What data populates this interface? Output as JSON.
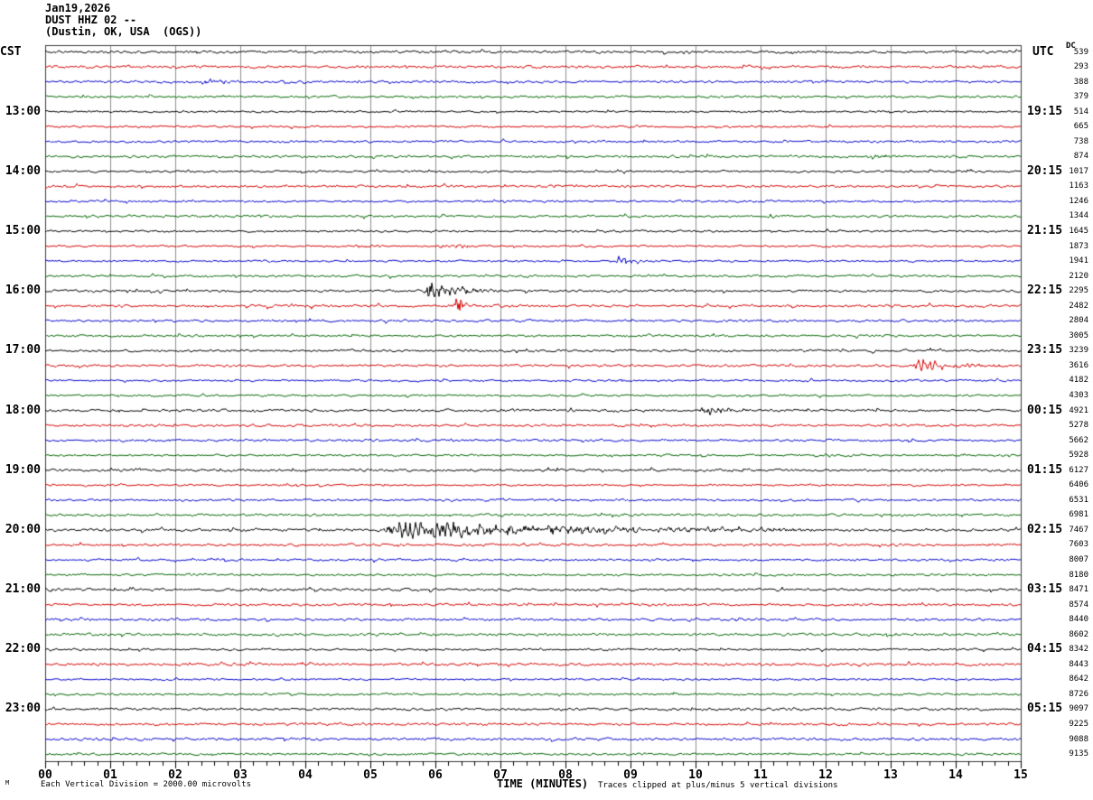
{
  "page": {
    "title_lines": [
      "Jan19,2026",
      "DUST HHZ 02 --",
      "(Dustin, OK, USA  (OGS))"
    ],
    "left_zone_label": "CST",
    "right_zone_label": "UTC",
    "dc_column_label": "DC",
    "corner_mark": "M"
  },
  "footer": {
    "scale_note": "Each Vertical Division = 2000.00 microvolts",
    "axis_label": "TIME (MINUTES)",
    "clip_note": "Traces clipped at plus/minus 5 vertical divisions"
  },
  "chart_data": {
    "type": "line",
    "subtype": "helicorder",
    "station": "DUST HHZ 02",
    "location": "(Dustin, OK, USA  (OGS))",
    "date": "Jan19,2026",
    "minutes_per_line": 15,
    "num_lines": 48,
    "x_axis": {
      "label": "TIME (MINUTES)",
      "tick_labels": [
        "00",
        "01",
        "02",
        "03",
        "04",
        "05",
        "06",
        "07",
        "08",
        "09",
        "10",
        "11",
        "12",
        "13",
        "14",
        "15"
      ],
      "minor_ticks_per_minute": 5
    },
    "trace_color_cycle": [
      "#000000",
      "#d40000",
      "#0000cc",
      "#006600"
    ],
    "grid_color": "#8e8e8e",
    "label_row_start": 4,
    "label_row_step": 4,
    "cst_hour_labels": [
      "13:00",
      "14:00",
      "15:00",
      "16:00",
      "17:00",
      "18:00",
      "19:00",
      "20:00",
      "21:00",
      "22:00",
      "23:00"
    ],
    "utc_quarter_labels": [
      "19:15",
      "20:15",
      "21:15",
      "22:15",
      "23:15",
      "00:15",
      "01:15",
      "02:15",
      "03:15",
      "04:15",
      "05:15"
    ],
    "dc_offsets_microvolts": [
      539,
      293,
      388,
      379,
      514,
      665,
      738,
      874,
      1017,
      1163,
      1246,
      1344,
      1645,
      1873,
      1941,
      2120,
      2295,
      2482,
      2804,
      3005,
      3239,
      3616,
      4182,
      4303,
      4921,
      5278,
      5662,
      5928,
      6127,
      6406,
      6531,
      6981,
      7467,
      7603,
      8007,
      8180,
      8471,
      8574,
      8440,
      8602,
      8342,
      8443,
      8642,
      8726,
      9097,
      9225,
      9088,
      9135
    ],
    "noise_base_amplitude": 1.9,
    "clip_amplitude": 13,
    "events": [
      {
        "row": 2,
        "start_min": 2.35,
        "end_min": 3.15,
        "amplitude": 5,
        "type": "burst"
      },
      {
        "row": 7,
        "start_min": 12.6,
        "end_min": 13.5,
        "amplitude": 5,
        "type": "burst"
      },
      {
        "row": 11,
        "start_min": 11.05,
        "end_min": 11.5,
        "amplitude": 4.5,
        "type": "burst"
      },
      {
        "row": 13,
        "start_min": 4.75,
        "end_min": 5.45,
        "amplitude": 4,
        "type": "burst"
      },
      {
        "row": 13,
        "start_min": 6.0,
        "end_min": 7.1,
        "amplitude": 3,
        "type": "burst"
      },
      {
        "row": 14,
        "start_min": 8.75,
        "end_min": 9.5,
        "amplitude": 6.5,
        "type": "burst"
      },
      {
        "row": 16,
        "start_min": 5.8,
        "end_min": 7.0,
        "amplitude": 13,
        "type": "quake"
      },
      {
        "row": 17,
        "start_min": 6.25,
        "end_min": 6.55,
        "amplitude": 11,
        "type": "spike"
      },
      {
        "row": 21,
        "start_min": 13.3,
        "end_min": 15.0,
        "amplitude": 9,
        "type": "quake"
      },
      {
        "row": 24,
        "start_min": 10.05,
        "end_min": 11.1,
        "amplitude": 7,
        "type": "quake"
      },
      {
        "row": 32,
        "start_min": 5.15,
        "end_min": 11.8,
        "amplitude": 11,
        "type": "quake-long"
      }
    ]
  }
}
